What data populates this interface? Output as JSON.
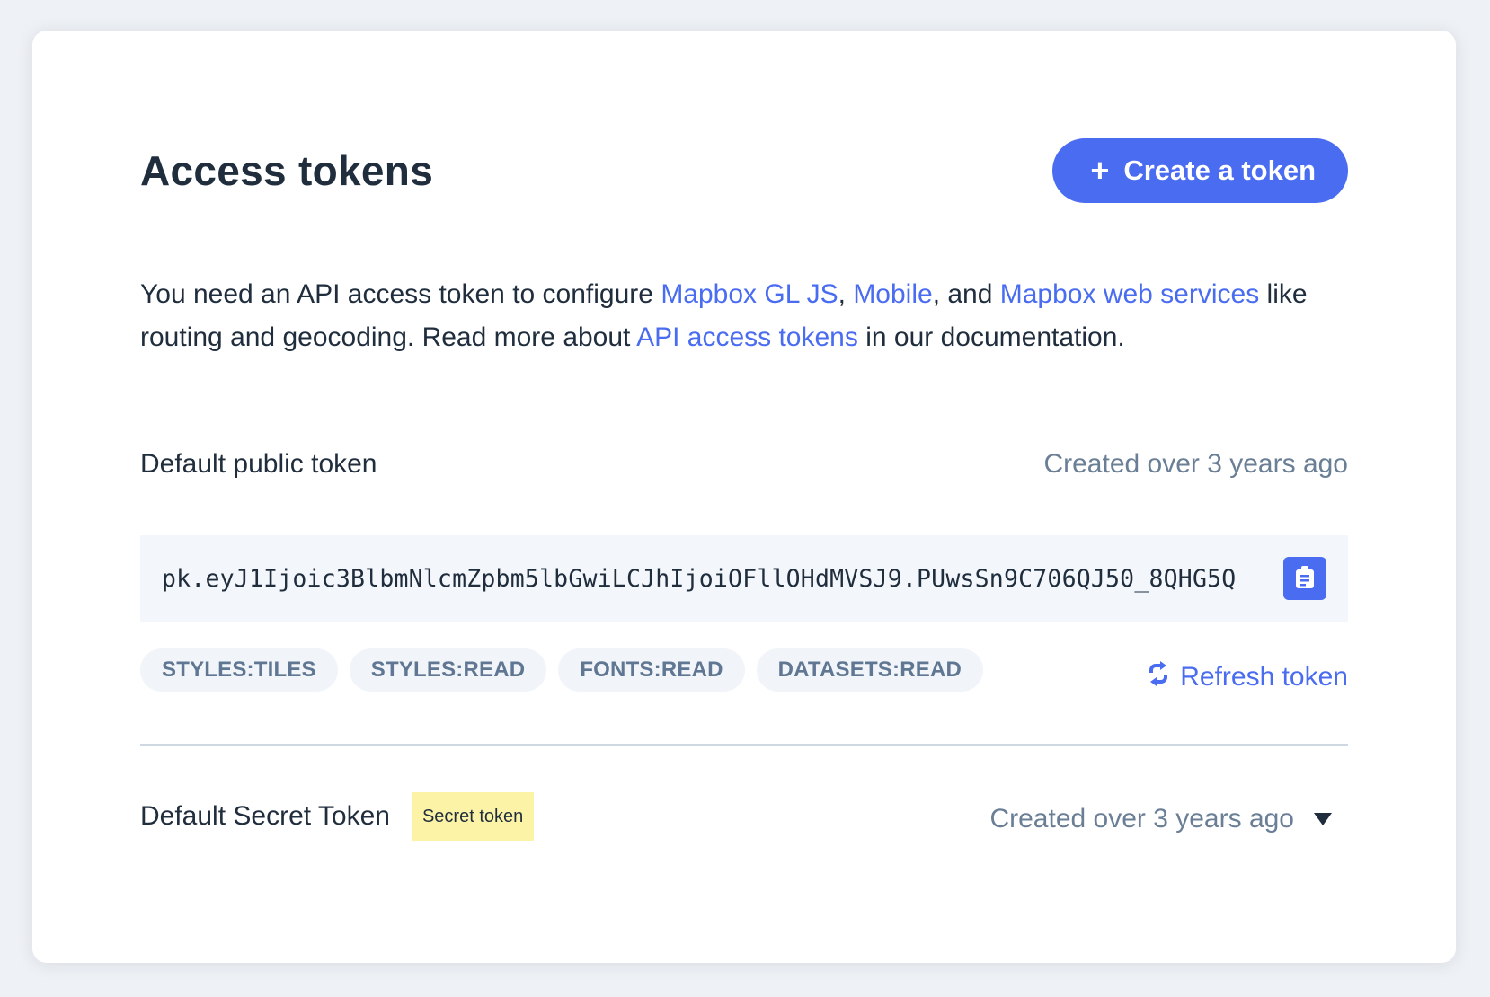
{
  "header": {
    "title": "Access tokens",
    "create_button": "Create a token"
  },
  "description": {
    "part1": "You need an API access token to configure ",
    "link_gl_js": "Mapbox GL JS",
    "sep1": ", ",
    "link_mobile": "Mobile",
    "part2": ", and ",
    "link_web_services": "Mapbox web services",
    "part3": " like routing and geocoding. Read more about ",
    "link_api_tokens": "API access tokens",
    "part4": " in our documentation."
  },
  "public_token": {
    "name": "Default public token",
    "created": "Created over 3 years ago",
    "value": "pk.eyJ1Ijoic3BlbmNlcmZpbm5lbGwiLCJhIjoiOFllOHdMVSJ9.PUwsSn9C706QJ50_8QHG5Q",
    "copy_icon": "clipboard-icon",
    "scopes": [
      "STYLES:TILES",
      "STYLES:READ",
      "FONTS:READ",
      "DATASETS:READ"
    ],
    "refresh_label": "Refresh token",
    "refresh_icon": "refresh-icon"
  },
  "secret_token": {
    "name": "Default Secret Token",
    "badge": "Secret token",
    "created": "Created over 3 years ago",
    "expand_icon": "caret-down-icon"
  },
  "colors": {
    "accent": "#4a6cf0",
    "badge_bg": "#fdf3a7",
    "muted_text": "#6a7f96",
    "token_bg": "#f3f6fa"
  }
}
